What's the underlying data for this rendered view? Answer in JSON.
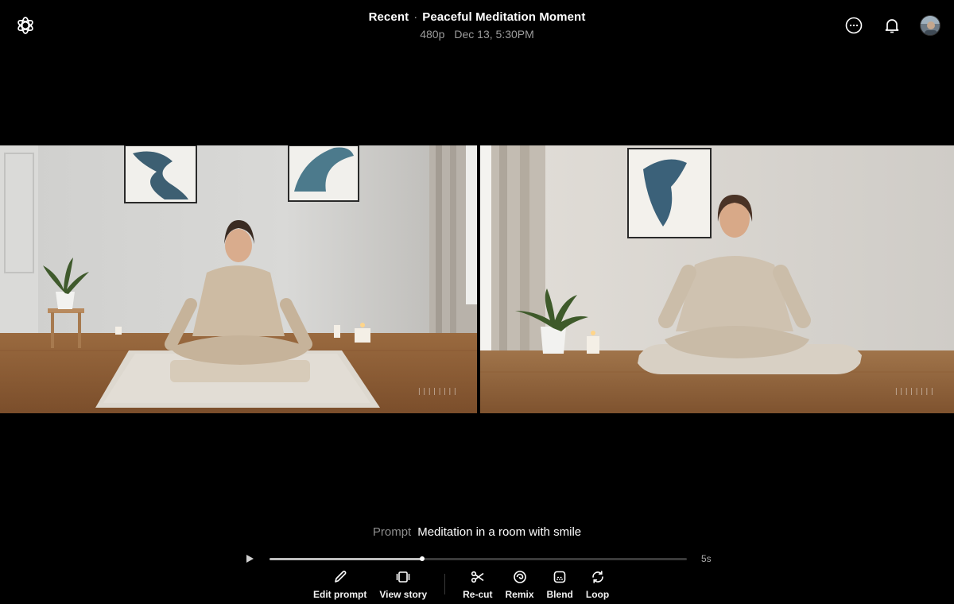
{
  "header": {
    "section": "Recent",
    "separator": "·",
    "title": "Peaceful Meditation Moment",
    "resolution": "480p",
    "timestamp": "Dec 13, 5:30PM"
  },
  "icons": {
    "logo": "openai-logo-icon",
    "more": "more-options-icon",
    "notifications": "bell-icon",
    "avatar": "user-avatar"
  },
  "frames": {
    "watermark_left": "||||||||",
    "watermark_right": "||||||||"
  },
  "prompt": {
    "label": "Prompt",
    "text": "Meditation in a room with smile"
  },
  "player": {
    "duration": "5s",
    "progress": 0.365
  },
  "toolbar": {
    "edit_prompt": "Edit prompt",
    "view_story": "View story",
    "recut": "Re-cut",
    "remix": "Remix",
    "blend": "Blend",
    "loop": "Loop"
  },
  "colors": {
    "background": "#000000",
    "text": "#ffffff",
    "muted": "#9c9c9c"
  }
}
